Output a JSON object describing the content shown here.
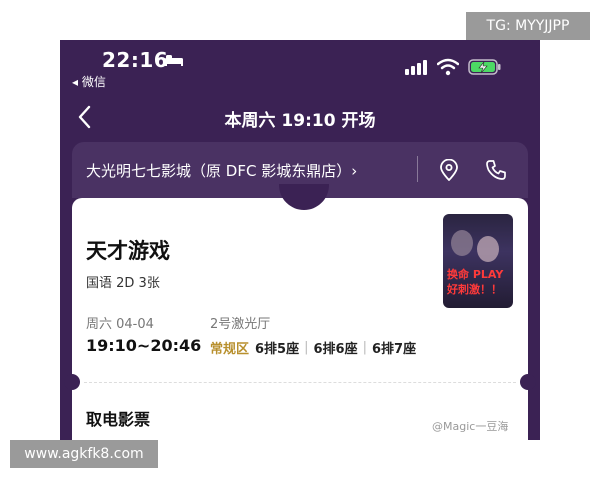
{
  "status_bar": {
    "time": "22:16",
    "back_app": "◂ 微信"
  },
  "nav": {
    "title": "本周六 19:10 开场"
  },
  "cinema": {
    "name": "大光明七七影城（原 DFC 影城东鼎店）›"
  },
  "film": {
    "title": "天才游戏",
    "meta": "国语 2D 3张",
    "poster_text": "换命 PLAY 好刺激！！",
    "date": "周六 04-04",
    "hall": "2号激光厅",
    "showtime": "19:10~20:46",
    "zone": "常规区",
    "seats": [
      "6排5座",
      "6排6座",
      "6排7座"
    ]
  },
  "pickup": {
    "label": "取电影票"
  },
  "watermarks": {
    "top_right": "TG: MYYJJPP",
    "bottom_left": "www.agkfk8.com",
    "bottom_right": "@Magic一豆海"
  },
  "colors": {
    "background": "#3b2254",
    "zone": "#b8902e",
    "poster_accent": "#ff3a3a"
  }
}
